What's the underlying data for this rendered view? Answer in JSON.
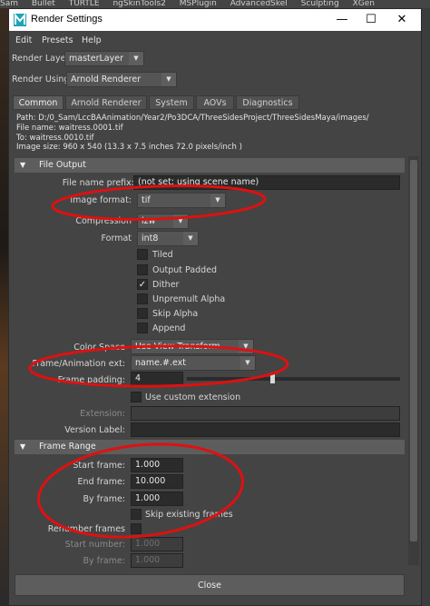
{
  "background": {
    "top_tabs": [
      "Sam",
      "Bullet",
      "TURTLE",
      "ngSkinTools2",
      "MSPlugin",
      "AdvancedSkel",
      "Sculpting",
      "XGen"
    ]
  },
  "window": {
    "title": "Render Settings",
    "icon": "maya-logo-icon",
    "minimize": "—",
    "maximize": "☐",
    "close": "✕"
  },
  "menu": [
    "Edit",
    "Presets",
    "Help"
  ],
  "render_layer": {
    "label": "Render Layer",
    "value": "masterLayer"
  },
  "render_using": {
    "label": "Render Using",
    "value": "Arnold Renderer"
  },
  "tabs": [
    "Common",
    "Arnold Renderer",
    "System",
    "AOVs",
    "Diagnostics"
  ],
  "active_tab": "Common",
  "info": {
    "path": "Path: D:/0_Sam/LccBAAnimation/Year2/Po3DCA/ThreeSidesProject/ThreeSidesMaya/images/",
    "file_name": "File name:  waitress.0001.tif",
    "to": "To:             waitress.0010.tif",
    "image_size": "Image size: 960 x 540 (13.3 x 7.5 inches 72.0 pixels/inch )"
  },
  "file_output": {
    "section_label": "File Output",
    "file_name_prefix": {
      "label": "File name prefix:",
      "value": "(not set; using scene name)"
    },
    "image_format": {
      "label": "Image format:",
      "value": "tif"
    },
    "compression": {
      "label": "Compression",
      "value": "lzw"
    },
    "format": {
      "label": "Format",
      "value": "int8"
    },
    "checkboxes": [
      {
        "label": "Tiled",
        "checked": false
      },
      {
        "label": "Output Padded",
        "checked": false
      },
      {
        "label": "Dither",
        "checked": true
      },
      {
        "label": "Unpremult Alpha",
        "checked": false
      },
      {
        "label": "Skip Alpha",
        "checked": false
      },
      {
        "label": "Append",
        "checked": false
      }
    ],
    "check_glyph": "✓",
    "color_space": {
      "label": "Color Space",
      "value": "Use View Transform"
    },
    "frame_animation_ext": {
      "label": "Frame/Animation ext:",
      "value": "name.#.ext"
    },
    "frame_padding": {
      "label": "Frame padding:",
      "value": "4"
    },
    "use_custom_extension": {
      "label": "Use custom extension",
      "checked": false
    },
    "extension": {
      "label": "Extension:",
      "value": ""
    },
    "version_label": {
      "label": "Version Label:",
      "value": ""
    }
  },
  "frame_range": {
    "section_label": "Frame Range",
    "start_frame": {
      "label": "Start frame:",
      "value": "1.000"
    },
    "end_frame": {
      "label": "End frame:",
      "value": "10.000"
    },
    "by_frame": {
      "label": "By frame:",
      "value": "1.000"
    },
    "skip_existing_frames": {
      "label": "Skip existing frames",
      "checked": false
    },
    "renumber_frames": {
      "label": "Renumber frames",
      "checked": false
    },
    "start_number": {
      "label": "Start number:",
      "value": "1.000"
    },
    "by_frame_renumber": {
      "label": "By frame:",
      "value": "1.000"
    }
  },
  "close_button": "Close",
  "colors": {
    "panel": "#444444",
    "section_header": "#5d5d5d",
    "field": "#2b2b2b",
    "annotation": "#e01010",
    "titlebar": "#ffffff"
  }
}
